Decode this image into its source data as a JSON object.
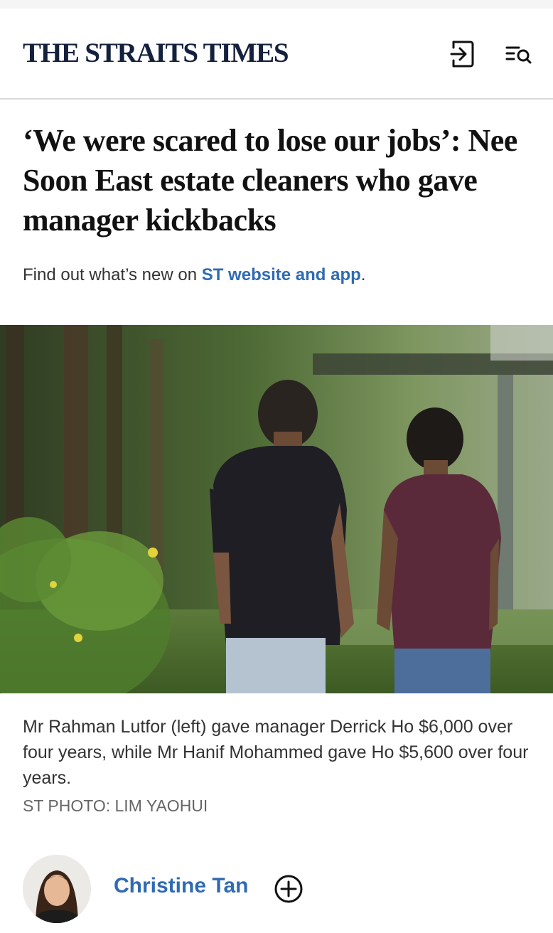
{
  "header": {
    "logo": "THE STRAITS TIMES",
    "login_icon": "login-icon",
    "menu_search_icon": "menu-search-icon"
  },
  "article": {
    "headline": "‘We were scared to lose our jobs’: Nee Soon East estate cleaners who gave manager kickbacks",
    "promo_prefix": "Find out what’s new on ",
    "promo_link": "ST website and app",
    "promo_suffix": ".",
    "caption": "Mr Rahman Lutfor (left) gave manager Derrick Ho $6,000 over four years, while Mr Hanif Mohammed gave Ho $5,600 over four years.",
    "photo_credit": "ST PHOTO: LIM YAOHUI"
  },
  "author": {
    "name": "Christine Tan",
    "follow_icon": "plus-circle-icon"
  },
  "colors": {
    "brand_navy": "#14213d",
    "link_blue": "#2f6bb3"
  }
}
